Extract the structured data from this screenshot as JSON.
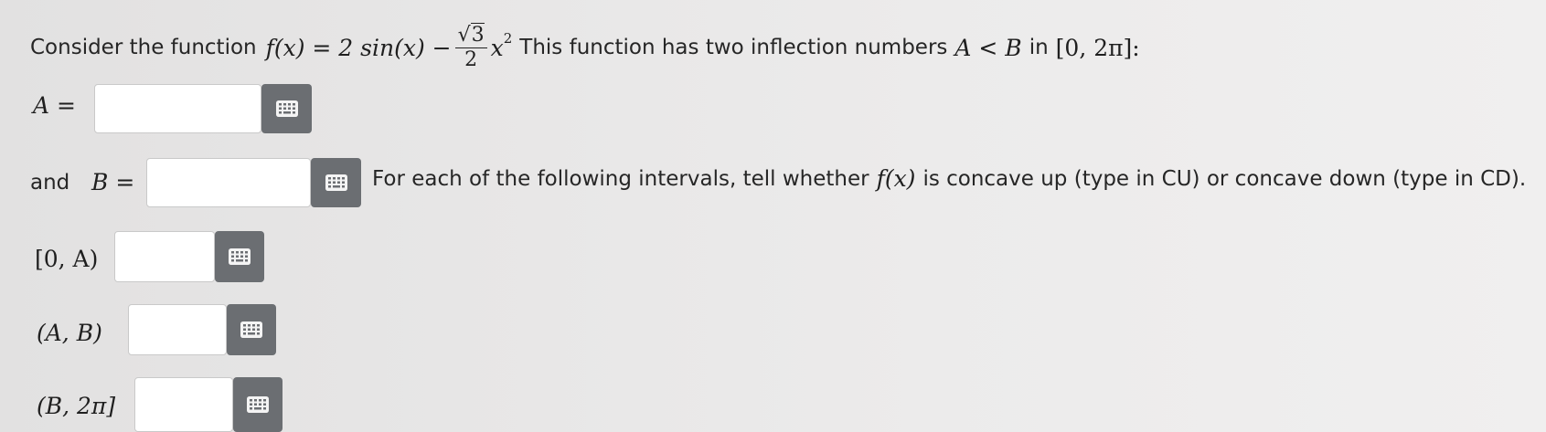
{
  "question": {
    "intro": "Consider the function",
    "function_lhs": "f(x) = 2 sin(x) −",
    "frac_num": "3",
    "frac_den": "2",
    "var_x": "x",
    "exp": "2",
    "statement": "This function has two inflection numbers",
    "relation": "A < B",
    "in_word": "in",
    "interval": "[0, 2π]:"
  },
  "fields": {
    "a_label": "A =",
    "and_word": "and",
    "b_label": "B =",
    "instruction": "For each of the following intervals, tell whether",
    "instruction_fx": "f(x)",
    "instruction_tail": "is concave up (type in CU) or concave down (type in CD).",
    "interval_1": "[0, A)",
    "interval_2": "(A, B)",
    "interval_3": "(B, 2π]"
  },
  "icons": {
    "keypad": "keypad-icon"
  },
  "colors": {
    "keypad_button": "#6b6e72",
    "box_border": "#c9c9c9"
  }
}
